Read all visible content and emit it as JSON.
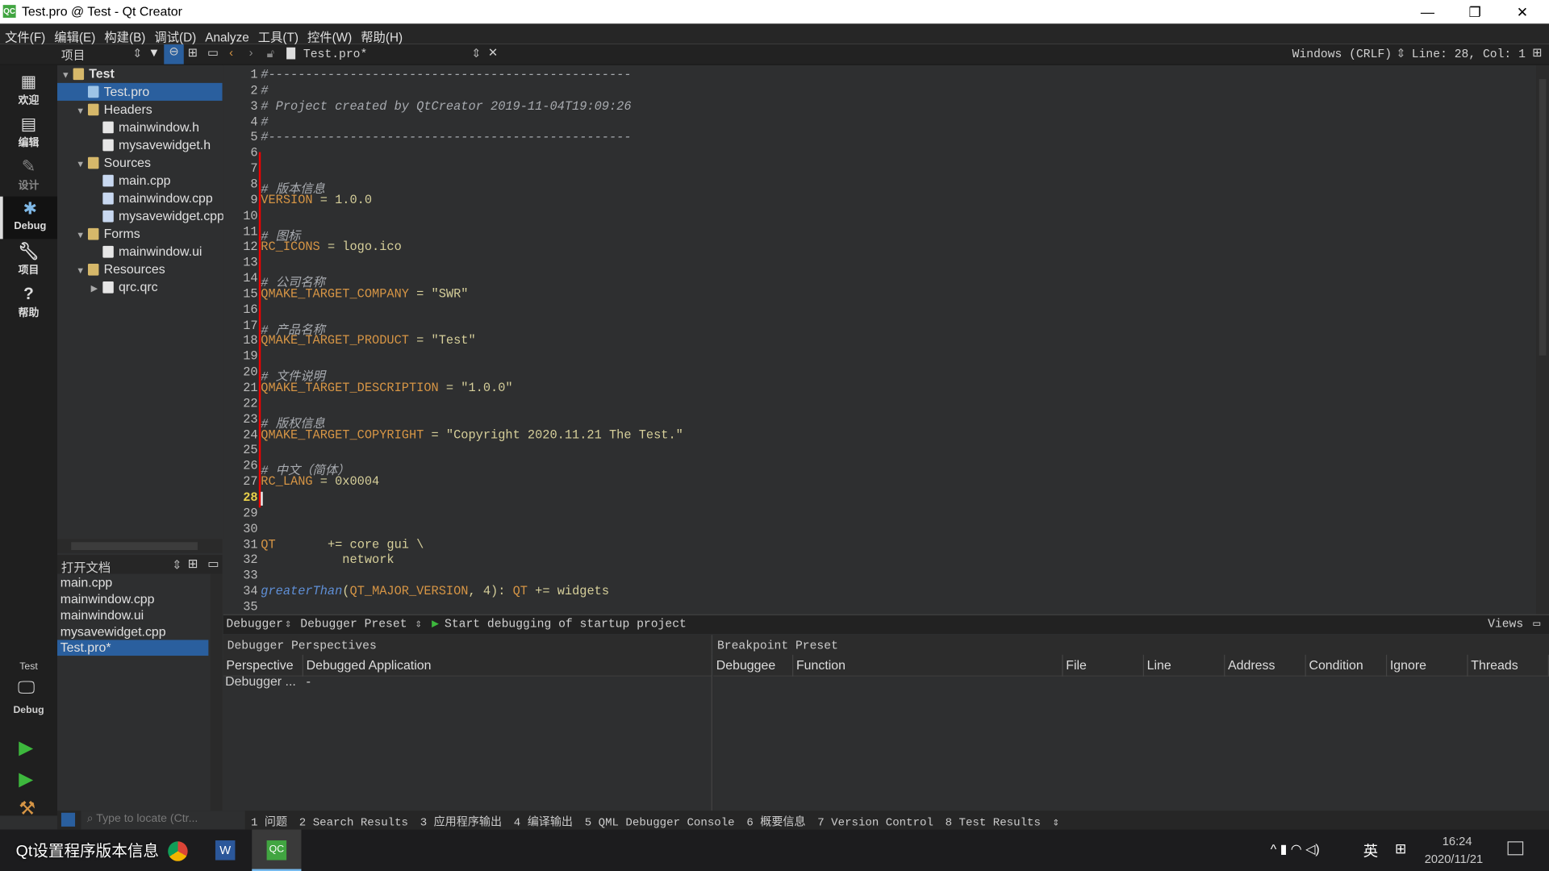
{
  "window": {
    "title": "Test.pro @ Test - Qt Creator",
    "logo": "QC",
    "minimize": "—",
    "maximize": "❐",
    "close": "✕"
  },
  "menu": [
    "文件(F)",
    "编辑(E)",
    "构建(B)",
    "调试(D)",
    "Analyze",
    "工具(T)",
    "控件(W)",
    "帮助(H)"
  ],
  "toolbar": {
    "project_selector": "项目",
    "open_file": "Test.pro*",
    "line_ending": "Windows (CRLF)",
    "position": "Line: 28, Col: 1"
  },
  "modes": [
    {
      "label": "欢迎",
      "icon": "grid-icon"
    },
    {
      "label": "编辑",
      "icon": "edit-icon"
    },
    {
      "label": "设计",
      "icon": "pencil-icon"
    },
    {
      "label": "Debug",
      "icon": "bug-icon"
    },
    {
      "label": "项目",
      "icon": "wrench-icon"
    },
    {
      "label": "帮助",
      "icon": "help-icon"
    }
  ],
  "kit": {
    "project": "Test",
    "mode": "Debug"
  },
  "tree": [
    {
      "label": "Test",
      "depth": 0,
      "arrow": "▼",
      "bold": true,
      "icon": "#d6b86a"
    },
    {
      "label": "Test.pro",
      "depth": 1,
      "selected": true,
      "icon": "#9ec4e6"
    },
    {
      "label": "Headers",
      "depth": 1,
      "arrow": "▼",
      "icon": "#d6b86a"
    },
    {
      "label": "mainwindow.h",
      "depth": 2,
      "icon": "#e6e6e6"
    },
    {
      "label": "mysavewidget.h",
      "depth": 2,
      "icon": "#e6e6e6"
    },
    {
      "label": "Sources",
      "depth": 1,
      "arrow": "▼",
      "icon": "#d6b86a"
    },
    {
      "label": "main.cpp",
      "depth": 2,
      "icon": "#c8d8f0"
    },
    {
      "label": "mainwindow.cpp",
      "depth": 2,
      "icon": "#c8d8f0"
    },
    {
      "label": "mysavewidget.cpp",
      "depth": 2,
      "icon": "#c8d8f0"
    },
    {
      "label": "Forms",
      "depth": 1,
      "arrow": "▼",
      "icon": "#d6b86a"
    },
    {
      "label": "mainwindow.ui",
      "depth": 2,
      "icon": "#e6e6e6"
    },
    {
      "label": "Resources",
      "depth": 1,
      "arrow": "▼",
      "icon": "#d6b86a"
    },
    {
      "label": "qrc.qrc",
      "depth": 2,
      "arrow": "▶",
      "icon": "#e6e6e6"
    }
  ],
  "open_docs": {
    "title": "打开文档",
    "items": [
      "main.cpp",
      "mainwindow.cpp",
      "mainwindow.ui",
      "mysavewidget.cpp",
      "Test.pro*"
    ],
    "selected": 4
  },
  "editor": {
    "current_line": 28,
    "lines": [
      [
        [
          "#-------------------------------------------------",
          "c"
        ]
      ],
      [
        [
          "#",
          "c"
        ]
      ],
      [
        [
          "# Project created by QtCreator 2019-11-04T19:09:26",
          "c"
        ]
      ],
      [
        [
          "#",
          "c"
        ]
      ],
      [
        [
          "#-------------------------------------------------",
          "c"
        ]
      ],
      [],
      [],
      [
        [
          "# 版本信息",
          "c"
        ]
      ],
      [
        [
          "VERSION",
          "k"
        ],
        [
          " = 1.0.0",
          "s"
        ]
      ],
      [],
      [
        [
          "# 图标",
          "c"
        ]
      ],
      [
        [
          "RC_ICONS",
          "k"
        ],
        [
          " = logo.ico",
          "s"
        ]
      ],
      [],
      [
        [
          "# 公司名称",
          "c"
        ]
      ],
      [
        [
          "QMAKE_TARGET_COMPANY",
          "k"
        ],
        [
          " = \"SWR\"",
          "s"
        ]
      ],
      [],
      [
        [
          "# 产品名称",
          "c"
        ]
      ],
      [
        [
          "QMAKE_TARGET_PRODUCT",
          "k"
        ],
        [
          " = \"Test\"",
          "s"
        ]
      ],
      [],
      [
        [
          "# 文件说明",
          "c"
        ]
      ],
      [
        [
          "QMAKE_TARGET_DESCRIPTION",
          "k"
        ],
        [
          " = \"1.0.0\"",
          "s"
        ]
      ],
      [],
      [
        [
          "# 版权信息",
          "c"
        ]
      ],
      [
        [
          "QMAKE_TARGET_COPYRIGHT",
          "k"
        ],
        [
          " = \"Copyright 2020.11.21 The Test.\"",
          "s"
        ]
      ],
      [],
      [
        [
          "# 中文（简体）",
          "c"
        ]
      ],
      [
        [
          "RC_LANG",
          "k"
        ],
        [
          " = 0x0004",
          "s"
        ]
      ],
      [],
      [],
      [],
      [
        [
          "QT",
          "k"
        ],
        [
          "       += core gui \\",
          "s"
        ]
      ],
      [
        [
          "           network",
          "s"
        ]
      ],
      [],
      [
        [
          "greaterThan",
          "f"
        ],
        [
          "(",
          "s"
        ],
        [
          "QT_MAJOR_VERSION",
          "k"
        ],
        [
          ", 4): ",
          "s"
        ],
        [
          "QT",
          "k"
        ],
        [
          " += widgets",
          "s"
        ]
      ],
      []
    ]
  },
  "debug_toolbar": {
    "debugger": "Debugger",
    "preset": "Debugger Preset",
    "start": "Start debugging of startup project",
    "views": "Views"
  },
  "perspectives": {
    "title": "Debugger Perspectives",
    "columns": [
      "Perspective",
      "Debugged Application"
    ],
    "rows": [
      [
        "Debugger ...",
        "-"
      ]
    ]
  },
  "breakpoints": {
    "title": "Breakpoint Preset",
    "columns": [
      "Debuggee",
      "Function",
      "File",
      "Line",
      "Address",
      "Condition",
      "Ignore",
      "Threads"
    ]
  },
  "output_bar": {
    "locator_placeholder": "Type to locate (Ctr...",
    "tabs": [
      "1 问题",
      "2 Search Results",
      "3 应用程序输出",
      "4 编译输出",
      "5 QML Debugger Console",
      "6 概要信息",
      "7 Version Control",
      "8 Test Results"
    ]
  },
  "taskbar": {
    "caption": "Qt设置程序版本信息",
    "time": "16:24",
    "date": "2020/11/21",
    "ime": "英"
  }
}
